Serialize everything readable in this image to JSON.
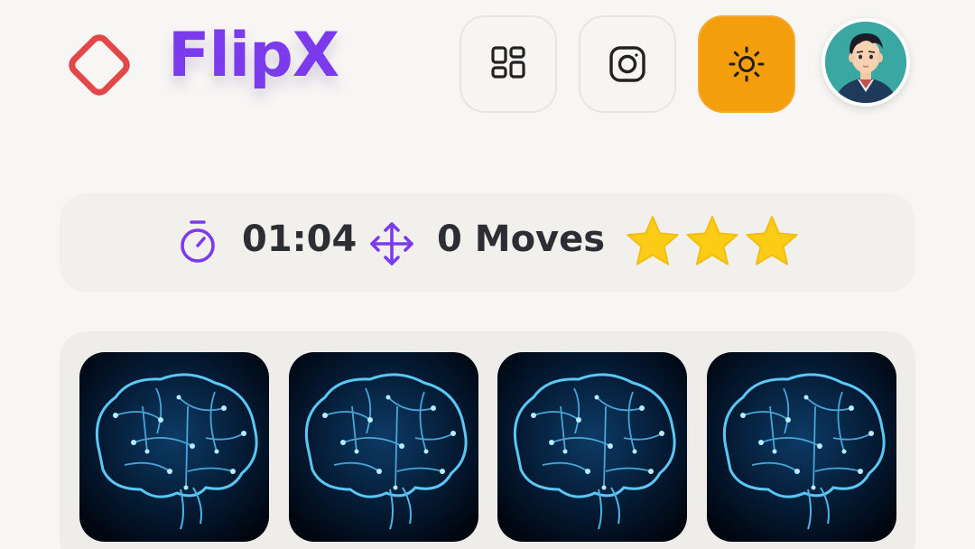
{
  "header": {
    "brand": "FlipX",
    "logo_icon": "diamond-outline-icon",
    "buttons": [
      {
        "name": "grid-button",
        "icon": "grid-icon"
      },
      {
        "name": "instagram-button",
        "icon": "instagram-icon"
      },
      {
        "name": "theme-toggle-button",
        "icon": "sun-icon"
      }
    ],
    "avatar": "user-avatar"
  },
  "stats": {
    "time": "01:04",
    "moves": "0 Moves",
    "stars": 3
  },
  "board": {
    "cards": [
      {
        "image": "circuit-brain"
      },
      {
        "image": "circuit-brain"
      },
      {
        "image": "circuit-brain"
      },
      {
        "image": "circuit-brain"
      }
    ]
  },
  "colors": {
    "accent": "#7c3aed",
    "logo": "#e24848",
    "theme_button": "#f59e0b",
    "star": "#facc15",
    "card_glow": "#38bdf8"
  }
}
